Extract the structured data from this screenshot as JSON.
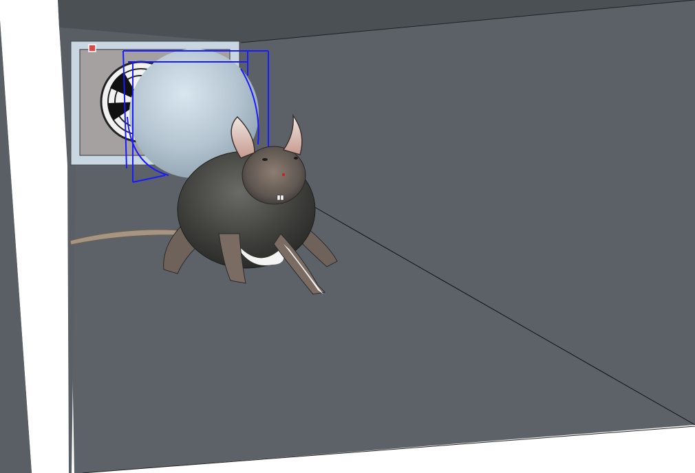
{
  "app": {
    "view": "3d-model-viewport"
  },
  "scene": {
    "colors": {
      "floor": "#5d6269",
      "right_wall": "#5c6168",
      "ceiling": "#4b5055",
      "outer_white": "#ffffff",
      "left_wall": "#595e64",
      "back_panel": "#c8d7e2",
      "vent_frame": "#a5a1a0",
      "sphere": "#b8c8d4",
      "selection": "#1a1aff",
      "rat_body": "#3a3a38",
      "rat_belly": "#f4f4f4",
      "rat_skin": "#d9b9a8"
    },
    "objects": {
      "box_room": "box-room",
      "exhaust_fan": "fan-icon",
      "sphere": "sphere",
      "rat_model": "rat-model",
      "selection_box": "selection-bounding-box",
      "gizmo_handle": "corner-handle-icon"
    }
  }
}
